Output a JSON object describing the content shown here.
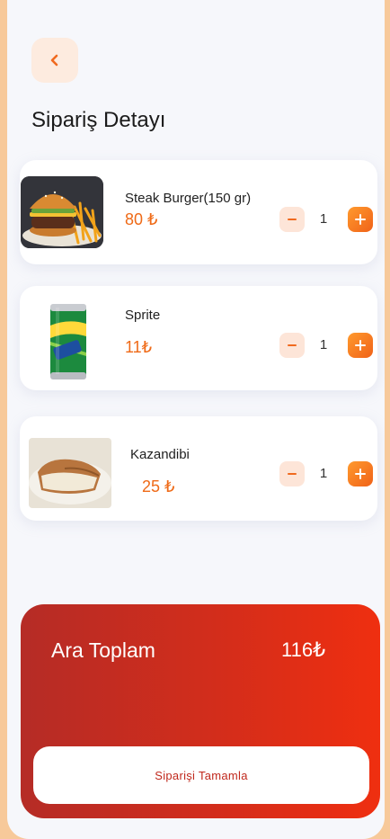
{
  "header": {
    "title": "Sipariş Detayı"
  },
  "items": [
    {
      "name": "Steak Burger(150 gr)",
      "price": "80 ₺",
      "quantity": "1",
      "image": "burger-photo"
    },
    {
      "name": "Sprite",
      "price": "11₺",
      "quantity": "1",
      "image": "sprite-can-photo"
    },
    {
      "name": "Kazandibi",
      "price": "25 ₺",
      "quantity": "1",
      "image": "kazandibi-photo"
    }
  ],
  "summary": {
    "label": "Ara Toplam",
    "total": "116₺",
    "complete_label": "Siparişi Tamamla"
  },
  "colors": {
    "accent": "#ef6a17",
    "summary_start": "#b52c26",
    "summary_end": "#ef2f10",
    "page_border": "#f7c99a"
  }
}
